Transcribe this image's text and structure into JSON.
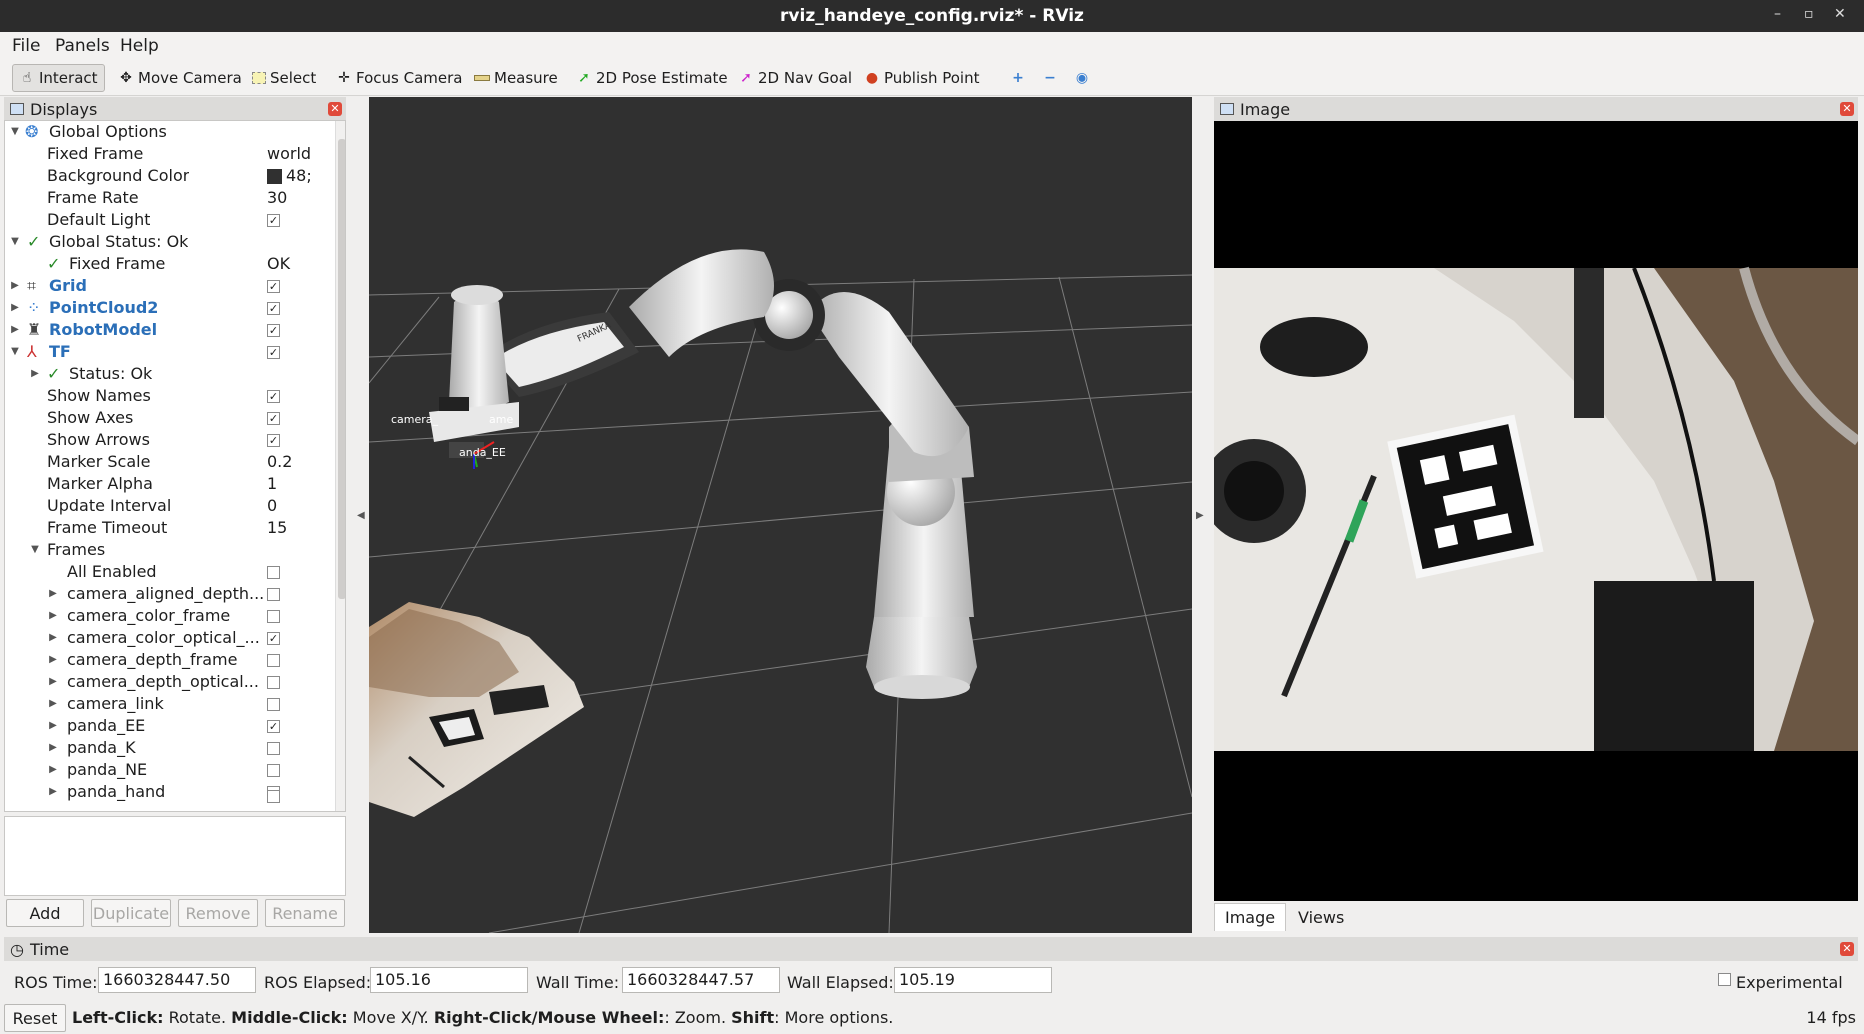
{
  "window": {
    "title": "rviz_handeye_config.rviz* - RViz"
  },
  "menu": {
    "file": "File",
    "panels": "Panels",
    "help": "Help"
  },
  "toolbar": {
    "interact": "Interact",
    "move_camera": "Move Camera",
    "select": "Select",
    "focus_camera": "Focus Camera",
    "measure": "Measure",
    "pose_estimate": "2D Pose Estimate",
    "nav_goal": "2D Nav Goal",
    "publish_point": "Publish Point"
  },
  "displays": {
    "title": "Displays",
    "global_options": "Global Options",
    "fixed_frame": {
      "label": "Fixed Frame",
      "value": "world"
    },
    "background_color": {
      "label": "Background Color",
      "value": "48;"
    },
    "frame_rate": {
      "label": "Frame Rate",
      "value": "30"
    },
    "default_light": {
      "label": "Default Light"
    },
    "global_status": "Global Status: Ok",
    "status_fixed_frame": {
      "label": "Fixed Frame",
      "value": "OK"
    },
    "grid": "Grid",
    "pointcloud2": "PointCloud2",
    "robotmodel": "RobotModel",
    "tf": "TF",
    "tf_status": "Status: Ok",
    "show_names": "Show Names",
    "show_axes": "Show Axes",
    "show_arrows": "Show Arrows",
    "marker_scale": {
      "label": "Marker Scale",
      "value": "0.2"
    },
    "marker_alpha": {
      "label": "Marker Alpha",
      "value": "1"
    },
    "update_interval": {
      "label": "Update Interval",
      "value": "0"
    },
    "frame_timeout": {
      "label": "Frame Timeout",
      "value": "15"
    },
    "frames": "Frames",
    "all_enabled": "All Enabled",
    "frame_items": [
      {
        "name": "camera_aligned_depth...",
        "checked": false
      },
      {
        "name": "camera_color_frame",
        "checked": false
      },
      {
        "name": "camera_color_optical_...",
        "checked": true
      },
      {
        "name": "camera_depth_frame",
        "checked": false
      },
      {
        "name": "camera_depth_optical...",
        "checked": false
      },
      {
        "name": "camera_link",
        "checked": false
      },
      {
        "name": "panda_EE",
        "checked": true
      },
      {
        "name": "panda_K",
        "checked": false
      },
      {
        "name": "panda_NE",
        "checked": false
      },
      {
        "name": "panda_hand",
        "checked": false
      }
    ]
  },
  "buttons": {
    "add": "Add",
    "duplicate": "Duplicate",
    "remove": "Remove",
    "rename": "Rename"
  },
  "view3d": {
    "label_camera": "camera_",
    "label_ame": "ame",
    "label_panda_ee": "anda_EE",
    "franka": "FRANKA"
  },
  "image_panel": {
    "title": "Image",
    "tab_image": "Image",
    "tab_views": "Views"
  },
  "time": {
    "title": "Time",
    "ros_time_label": "ROS Time:",
    "ros_time": "1660328447.50",
    "ros_elapsed_label": "ROS Elapsed:",
    "ros_elapsed": "105.16",
    "wall_time_label": "Wall Time:",
    "wall_time": "1660328447.57",
    "wall_elapsed_label": "Wall Elapsed:",
    "wall_elapsed": "105.19",
    "experimental": "Experimental"
  },
  "status": {
    "reset": "Reset",
    "left_click": "Left-Click:",
    "left_click_desc": " Rotate. ",
    "middle_click": "Middle-Click:",
    "middle_click_desc": " Move X/Y. ",
    "right_click": "Right-Click/Mouse Wheel:",
    "right_click_desc": ": Zoom. ",
    "shift": "Shift",
    "shift_desc": ": More options.",
    "fps": "14 fps"
  },
  "colors": {
    "view_background": "#303030",
    "title_bar": "#2c2c2c",
    "link_blue": "#2b6fb8",
    "close_red": "#e04a3a"
  }
}
